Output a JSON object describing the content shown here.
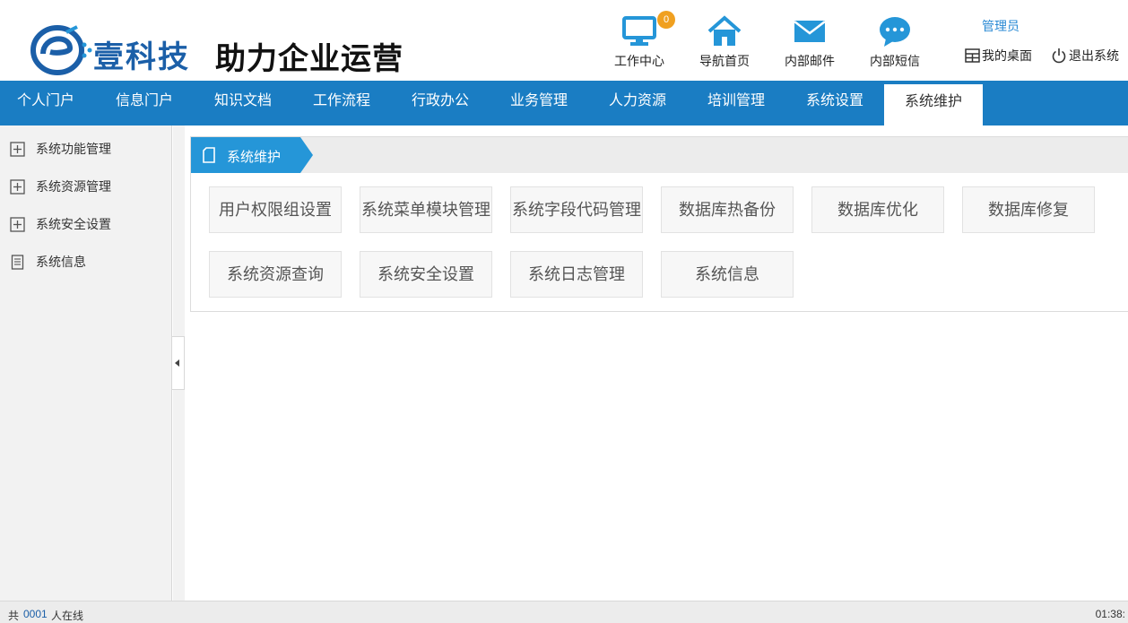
{
  "header": {
    "brand": "壹科技",
    "slogan": "助力企业运营",
    "badge_count": "0",
    "top_nav": [
      {
        "label": "工作中心",
        "icon": "monitor-icon"
      },
      {
        "label": "导航首页",
        "icon": "home-icon"
      },
      {
        "label": "内部邮件",
        "icon": "mail-icon"
      },
      {
        "label": "内部短信",
        "icon": "chat-bubble-icon"
      }
    ],
    "user_role": "管理员",
    "desktop_link": "我的桌面",
    "logout_link": "退出系统"
  },
  "main_nav": {
    "tabs": [
      {
        "label": "个人门户"
      },
      {
        "label": "信息门户"
      },
      {
        "label": "知识文档"
      },
      {
        "label": "工作流程"
      },
      {
        "label": "行政办公"
      },
      {
        "label": "业务管理"
      },
      {
        "label": "人力资源"
      },
      {
        "label": "培训管理"
      },
      {
        "label": "系统设置"
      },
      {
        "label": "系统维护"
      }
    ],
    "active_tab": "系统维护"
  },
  "sidebar": {
    "items": [
      {
        "label": "系统功能管理",
        "icon": "plus-box-icon"
      },
      {
        "label": "系统资源管理",
        "icon": "plus-box-icon"
      },
      {
        "label": "系统安全设置",
        "icon": "plus-box-icon"
      },
      {
        "label": "系统信息",
        "icon": "document-icon"
      }
    ]
  },
  "panel": {
    "title": "系统维护",
    "buttons": [
      {
        "label": "用户权限组设置"
      },
      {
        "label": "系统菜单模块管理"
      },
      {
        "label": "系统字段代码管理"
      },
      {
        "label": "数据库热备份"
      },
      {
        "label": "数据库优化"
      },
      {
        "label": "数据库修复"
      },
      {
        "label": "系统资源查询"
      },
      {
        "label": "系统安全设置"
      },
      {
        "label": "系统日志管理"
      },
      {
        "label": "系统信息"
      }
    ]
  },
  "footer": {
    "prefix": "共",
    "online_count": "0001",
    "suffix": "人在线",
    "time": "01:38:"
  },
  "colors": {
    "nav_blue": "#1a7dc3",
    "title_blue": "#2596d8",
    "badge_orange": "#f0a020",
    "brand_blue": "#1b5fa8"
  }
}
